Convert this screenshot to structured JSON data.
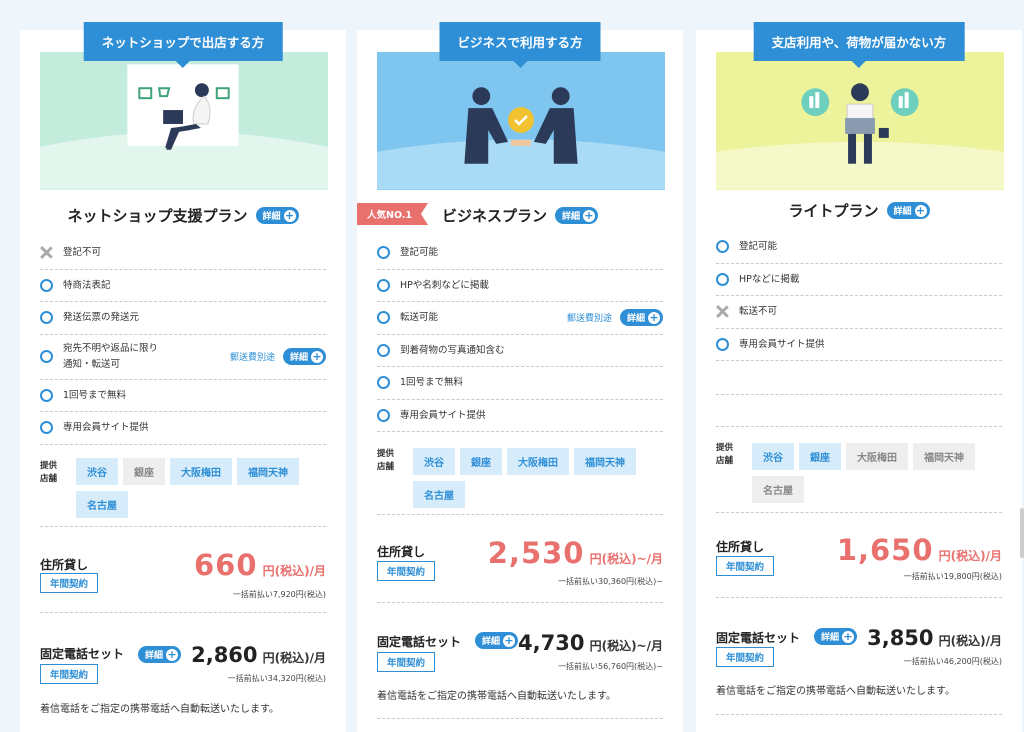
{
  "colors": {
    "accent": "#2f8fd6",
    "price": "#e8716e",
    "popular_badge": "#e8716e"
  },
  "detail_label": "詳細",
  "plans": [
    {
      "header": "ネットショップで出店する方",
      "name": "ネットショップ支援プラン",
      "features": [
        {
          "icon": "cross-icon",
          "text": "登記不可"
        },
        {
          "icon": "circle-icon",
          "text": "特商法表記"
        },
        {
          "icon": "circle-icon",
          "text": "発送伝票の発送元"
        },
        {
          "icon": "circle-icon",
          "text": "宛先不明や返品に限り\n通知・転送可",
          "note": "郵送費別途"
        },
        {
          "icon": "circle-icon",
          "text": "1回号まで無料"
        },
        {
          "icon": "circle-icon",
          "text": "専用会員サイト提供"
        }
      ],
      "stores_label": "提供\n店舗",
      "stores": [
        {
          "name": "渋谷",
          "available": true
        },
        {
          "name": "銀座",
          "available": false
        },
        {
          "name": "大阪梅田",
          "available": true
        },
        {
          "name": "福岡天神",
          "available": true
        },
        {
          "name": "名古屋",
          "available": true
        }
      ],
      "address": {
        "label": "住所貸し",
        "contract": "年間契約",
        "price": "660",
        "unit": "円(税込)/月",
        "sub": "一括前払い7,920円(税込)"
      },
      "phone": {
        "label": "固定電話セット",
        "contract": "年間契約",
        "price": "2,860",
        "unit": "円(税込)/月",
        "sub": "一括前払い34,320円(税込)"
      },
      "phone_desc": "着信電話をご指定の携帯電話へ自動転送いたします。"
    },
    {
      "header": "ビジネスで利用する方",
      "badge": "人気NO.1",
      "name": "ビジネスプラン",
      "features": [
        {
          "icon": "circle-icon",
          "text": "登記可能"
        },
        {
          "icon": "circle-icon",
          "text": "HPや名刺などに掲載"
        },
        {
          "icon": "circle-icon",
          "text": "転送可能",
          "note": "郵送費別途"
        },
        {
          "icon": "circle-icon",
          "text": "到着荷物の写真通知含む"
        },
        {
          "icon": "circle-icon",
          "text": "1回号まで無料"
        },
        {
          "icon": "circle-icon",
          "text": "専用会員サイト提供"
        }
      ],
      "stores_label": "提供\n店舗",
      "stores": [
        {
          "name": "渋谷",
          "available": true
        },
        {
          "name": "銀座",
          "available": true
        },
        {
          "name": "大阪梅田",
          "available": true
        },
        {
          "name": "福岡天神",
          "available": true
        },
        {
          "name": "名古屋",
          "available": true
        }
      ],
      "address": {
        "label": "住所貸し",
        "contract": "年間契約",
        "price": "2,530",
        "unit": "円(税込)~/月",
        "sub": "一括前払い30,360円(税込)~"
      },
      "phone": {
        "label": "固定電話セット",
        "contract": "年間契約",
        "price": "4,730",
        "unit": "円(税込)~/月",
        "sub": "一括前払い56,760円(税込)~"
      },
      "phone_desc": "着信電話をご指定の携帯電話へ自動転送いたします。"
    },
    {
      "header": "支店利用や、荷物が届かない方",
      "name": "ライトプラン",
      "features": [
        {
          "icon": "circle-icon",
          "text": "登記可能"
        },
        {
          "icon": "circle-icon",
          "text": "HPなどに掲載"
        },
        {
          "icon": "cross-icon",
          "text": "転送不可"
        },
        {
          "icon": "circle-icon",
          "text": "専用会員サイト提供"
        }
      ],
      "stores_label": "提供\n店舗",
      "stores": [
        {
          "name": "渋谷",
          "available": true
        },
        {
          "name": "銀座",
          "available": true
        },
        {
          "name": "大阪梅田",
          "available": false
        },
        {
          "name": "福岡天神",
          "available": false
        },
        {
          "name": "名古屋",
          "available": false
        }
      ],
      "address": {
        "label": "住所貸し",
        "contract": "年間契約",
        "price": "1,650",
        "unit": "円(税込)/月",
        "sub": "一括前払い19,800円(税込)"
      },
      "phone": {
        "label": "固定電話セット",
        "contract": "年間契約",
        "price": "3,850",
        "unit": "円(税込)/月",
        "sub": "一括前払い46,200円(税込)"
      },
      "phone_desc": "着信電話をご指定の携帯電話へ自動転送いたします。"
    }
  ]
}
